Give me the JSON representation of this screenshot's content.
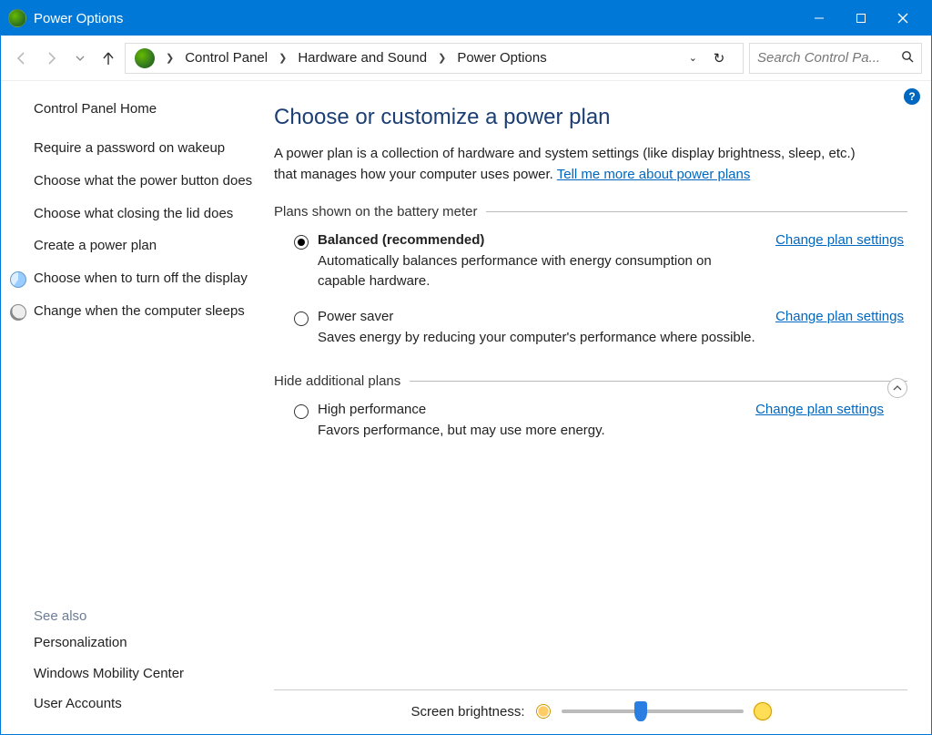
{
  "window": {
    "title": "Power Options"
  },
  "breadcrumb": {
    "items": [
      "Control Panel",
      "Hardware and Sound",
      "Power Options"
    ]
  },
  "search": {
    "placeholder": "Search Control Pa..."
  },
  "sidebar": {
    "home": "Control Panel Home",
    "links": [
      "Require a password on wakeup",
      "Choose what the power button does",
      "Choose what closing the lid does",
      "Create a power plan",
      "Choose when to turn off the display",
      "Change when the computer sleeps"
    ],
    "see_also_header": "See also",
    "see_also": [
      "Personalization",
      "Windows Mobility Center",
      "User Accounts"
    ]
  },
  "main": {
    "heading": "Choose or customize a power plan",
    "intro_text": "A power plan is a collection of hardware and system settings (like display brightness, sleep, etc.) that manages how your computer uses power. ",
    "intro_link": "Tell me more about power plans",
    "group1_legend": "Plans shown on the battery meter",
    "group2_legend": "Hide additional plans",
    "change_label": "Change plan settings",
    "plans": [
      {
        "name": "Balanced (recommended)",
        "desc": "Automatically balances performance with energy consumption on capable hardware.",
        "selected": true,
        "bold": true
      },
      {
        "name": "Power saver",
        "desc": "Saves energy by reducing your computer's performance where possible.",
        "selected": false,
        "bold": false
      }
    ],
    "additional_plans": [
      {
        "name": "High performance",
        "desc": "Favors performance, but may use more energy.",
        "selected": false,
        "bold": false
      }
    ],
    "brightness_label": "Screen brightness:"
  }
}
